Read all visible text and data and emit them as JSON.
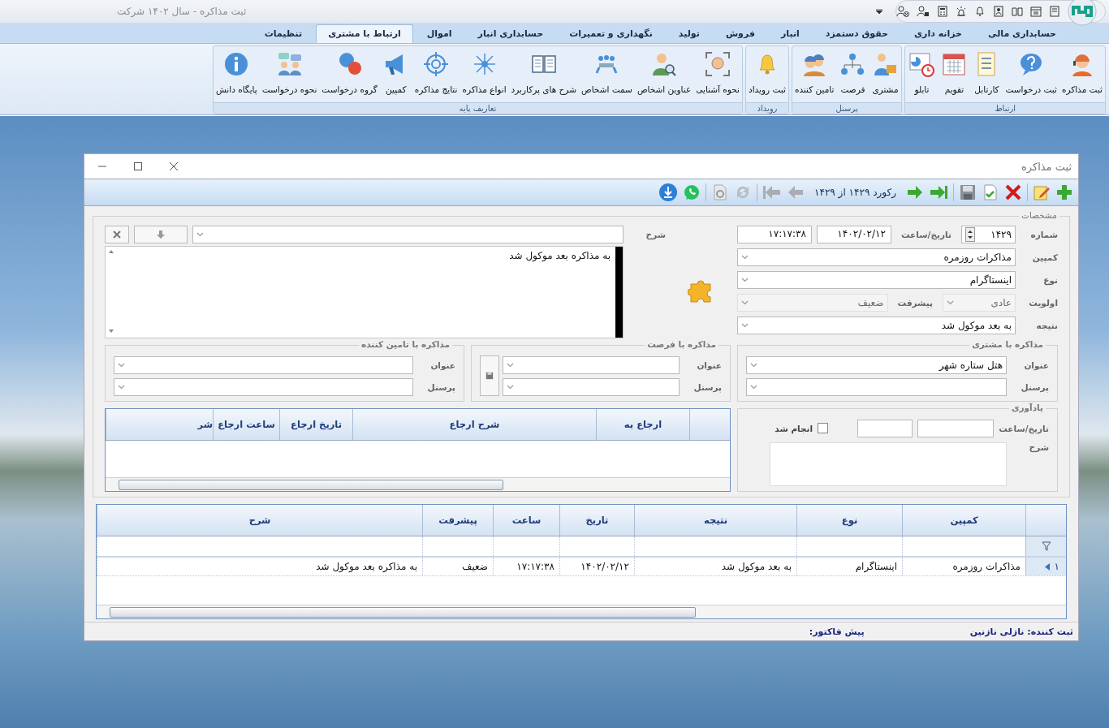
{
  "app": {
    "title": "ثبت مذاکره - سال ۱۴۰۲ شرکت"
  },
  "menu_tabs": [
    {
      "label": "حسابداری مالی",
      "selected": false
    },
    {
      "label": "خزانه داری",
      "selected": false
    },
    {
      "label": "حقوق دستمزد",
      "selected": false
    },
    {
      "label": "انبار",
      "selected": false
    },
    {
      "label": "فروش",
      "selected": false
    },
    {
      "label": "تولید",
      "selected": false
    },
    {
      "label": "نگهداری و تعمیرات",
      "selected": false
    },
    {
      "label": "حسابداری انبار",
      "selected": false
    },
    {
      "label": "اموال",
      "selected": false
    },
    {
      "label": "ارتباط با مشتری",
      "selected": true
    },
    {
      "label": "تنظیمات",
      "selected": false
    }
  ],
  "ribbon_groups": [
    {
      "title": "ارتباط",
      "buttons": [
        {
          "label": "ثبت مذاکره",
          "kind": "agent"
        },
        {
          "label": "ثبت درخواست",
          "kind": "help"
        },
        {
          "label": "کارتابل",
          "kind": "checklist"
        },
        {
          "label": "تقویم",
          "kind": "calendar"
        },
        {
          "label": "تابلو",
          "kind": "board"
        }
      ]
    },
    {
      "title": "پرسنل",
      "buttons": [
        {
          "label": "مشتری",
          "kind": "customer"
        },
        {
          "label": "فرصت",
          "kind": "org"
        },
        {
          "label": "تامین کننده",
          "kind": "workers"
        }
      ]
    },
    {
      "title": "رویداد",
      "buttons": [
        {
          "label": "ثبت رویداد",
          "kind": "bell"
        }
      ]
    },
    {
      "title": "تعاریف پایه",
      "buttons": [
        {
          "label": "نحوه آشنایی",
          "kind": "face"
        },
        {
          "label": "عناوین اشخاص",
          "kind": "search-person"
        },
        {
          "label": "سمت اشخاص",
          "kind": "meeting"
        },
        {
          "label": "شرح های پرکاربرد",
          "kind": "book"
        },
        {
          "label": "انواع مذاکره",
          "kind": "hub"
        },
        {
          "label": "نتایج مذاکره",
          "kind": "target"
        },
        {
          "label": "کمپین",
          "kind": "megaphone"
        },
        {
          "label": "گروه درخواست",
          "kind": "qa"
        },
        {
          "label": "نحوه درخواست",
          "kind": "people-chat"
        },
        {
          "label": "پایگاه دانش",
          "kind": "info"
        }
      ]
    }
  ],
  "dialog": {
    "title": "ثبت مذاکره",
    "record": "رکورد ۱۴۲۹ از ۱۴۲۹",
    "details": {
      "title": "مشخصات",
      "number": {
        "label": "شماره",
        "value": "۱۴۲۹"
      },
      "datetime": {
        "label": "تاریخ/ساعت",
        "date": "۱۴۰۲/۰۲/۱۲",
        "time": "۱۷:۱۷:۳۸"
      },
      "campaign": {
        "label": "کمپین",
        "value": "مذاکرات روزمره",
        "disabled": false
      },
      "type": {
        "label": "نوع",
        "value": "اینستاگرام",
        "disabled": false
      },
      "priority": {
        "label": "اولویت",
        "value": "عادی",
        "disabled": true
      },
      "progress": {
        "label": "پیشرفت",
        "value": "ضعیف",
        "disabled": true
      },
      "result": {
        "label": "نتیجه",
        "value": "به بعد موکول شد",
        "disabled": false
      },
      "description": {
        "label": "شرح",
        "text": "به مذاکره بعد موکول شد"
      }
    },
    "contact_groups": [
      {
        "title": "مذاکره با مشتری",
        "save_button": false,
        "fields": [
          {
            "label": "عنوان",
            "value": "هتل ستاره شهر"
          },
          {
            "label": "پرسنل"
          }
        ]
      },
      {
        "title": "مذاکره با فرصت",
        "save_button": true,
        "fields": [
          {
            "label": "عنوان"
          },
          {
            "label": "پرسنل"
          }
        ]
      },
      {
        "title": "مذاکره با تامین کننده",
        "save_button": false,
        "fields": [
          {
            "label": "عنوان"
          },
          {
            "label": "پرسنل"
          }
        ]
      }
    ],
    "referrals": {
      "columns": [
        "ارجاع به",
        "شرح ارجاع",
        "تاریخ ارجاع",
        "ساعت ارجاع",
        "شر"
      ]
    },
    "reminder": {
      "title": "یادآوری",
      "datetime_label": "تاریخ/ساعت",
      "done": {
        "label": "انجام شد",
        "checked": false
      },
      "description_label": "شرح"
    },
    "grid": {
      "columns": [
        "کمپین",
        "نوع",
        "نتیجه",
        "تاریخ",
        "ساعت",
        "پیشرفت",
        "شرح"
      ],
      "rows": [
        {
          "number": "۱",
          "current": true,
          "cells": [
            "مذاکرات روزمره",
            "اینستاگرام",
            "به بعد موکول شد",
            "۱۴۰۲/۰۲/۱۲",
            "۱۷:۱۷:۳۸",
            "ضعیف",
            "به مذاکره بعد موکول شد"
          ]
        }
      ]
    },
    "status": {
      "created_by": "ثبت کننده: نازلی نازنین",
      "invoice": "پیش فاکتور:"
    }
  }
}
